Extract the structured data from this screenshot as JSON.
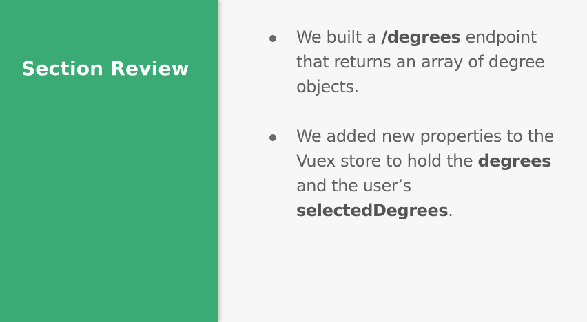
{
  "slide": {
    "title": "Section Review",
    "colors": {
      "accent_panel": "#3aab74",
      "background": "#f7f7f7",
      "body_text": "#5f5f5f",
      "title_text": "#ffffff"
    },
    "bullets": [
      {
        "lines": [
          [
            {
              "text": "We built a ",
              "bold": false
            },
            {
              "text": "/degrees",
              "bold": true
            },
            {
              "text": " endpoint",
              "bold": false
            }
          ],
          [
            {
              "text": "that returns an array of degree",
              "bold": false
            }
          ],
          [
            {
              "text": "objects.",
              "bold": false
            }
          ]
        ]
      },
      {
        "lines": [
          [
            {
              "text": "We added new properties to the",
              "bold": false
            }
          ],
          [
            {
              "text": "Vuex store to hold the ",
              "bold": false
            },
            {
              "text": "degrees",
              "bold": true
            }
          ],
          [
            {
              "text": "and the user’s",
              "bold": false
            }
          ],
          [
            {
              "text": "selectedDegrees",
              "bold": true
            },
            {
              "text": ".",
              "bold": false
            }
          ]
        ]
      }
    ]
  }
}
